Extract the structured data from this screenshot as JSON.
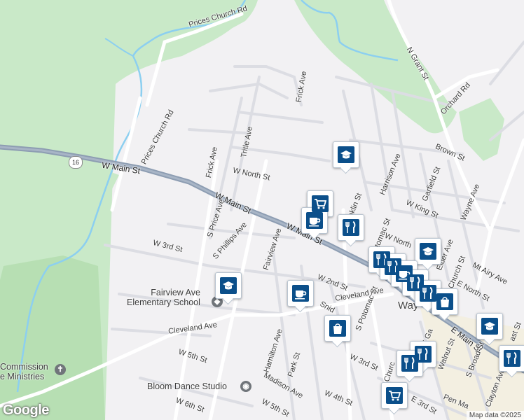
{
  "map": {
    "colors": {
      "land": "#f2f1f3",
      "forest": "#c9e9c8",
      "water": "#8ccff0",
      "highway": "#8d9db2",
      "street": "#ffffff",
      "minor": "#dcdde3",
      "marker": "#0b4f8a",
      "town": "#f4ecd2"
    },
    "route_shield": "16",
    "streets": [
      {
        "id": "prices-church-rd-top",
        "label": "Prices Church Rd"
      },
      {
        "id": "prices-church-rd-mid",
        "label": "Prices Church Rd"
      },
      {
        "id": "w-main-st-west",
        "label": "W Main St"
      },
      {
        "id": "w-main-st-center",
        "label": "W Main St"
      },
      {
        "id": "w-main-st-east",
        "label": "W Main St"
      },
      {
        "id": "e-main-st",
        "label": "E Main St"
      },
      {
        "id": "frick-ave-north",
        "label": "Frick Ave"
      },
      {
        "id": "frick-ave-west",
        "label": "Frick Ave"
      },
      {
        "id": "tritle-ave",
        "label": "Tritle Ave"
      },
      {
        "id": "w-north-st",
        "label": "W North St"
      },
      {
        "id": "w-north-st-east",
        "label": "W North"
      },
      {
        "id": "s-price-ave",
        "label": "S Price Ave"
      },
      {
        "id": "s-phillips-ave",
        "label": "S Phillips Ave"
      },
      {
        "id": "w-3rd-st-west",
        "label": "W 3rd St"
      },
      {
        "id": "fairview-ave",
        "label": "Fairview Ave"
      },
      {
        "id": "w-2nd-st",
        "label": "W 2nd St"
      },
      {
        "id": "cleveland-ave-east",
        "label": "Cleveland Ave"
      },
      {
        "id": "cleveland-ave-west",
        "label": "Cleveland Ave"
      },
      {
        "id": "w-5th-st-west",
        "label": "W 5th St"
      },
      {
        "id": "hamilton-ave",
        "label": "Hamilton Ave"
      },
      {
        "id": "park-st",
        "label": "Park St"
      },
      {
        "id": "madison-ave",
        "label": "Madison Ave"
      },
      {
        "id": "w-6th-st",
        "label": "W 6th St"
      },
      {
        "id": "w-5th-st-east",
        "label": "W 5th St"
      },
      {
        "id": "w-4th-st",
        "label": "W 4th St"
      },
      {
        "id": "w-3rd-st-east",
        "label": "W 3rd St"
      },
      {
        "id": "s-potomac-st",
        "label": "S Potomac St"
      },
      {
        "id": "snider",
        "label": "Snid"
      },
      {
        "id": "s-church",
        "label": "S Churc"
      },
      {
        "id": "e-3rd-st",
        "label": "E 3rd St"
      },
      {
        "id": "pen-mar",
        "label": "Pen Ma"
      },
      {
        "id": "clayton-ave",
        "label": "Clayton Ave"
      },
      {
        "id": "s-broad-st",
        "label": "S Broad St"
      },
      {
        "id": "walnut-st",
        "label": "Walnut St"
      },
      {
        "id": "e-gay-st",
        "label": "E Ga"
      },
      {
        "id": "n-grant-st",
        "label": "N Grant St"
      },
      {
        "id": "orchard-rd",
        "label": "Orchard Rd"
      },
      {
        "id": "brown-st",
        "label": "Brown St"
      },
      {
        "id": "harrison-ave",
        "label": "Harrison Ave"
      },
      {
        "id": "garfield-st",
        "label": "Garfield St"
      },
      {
        "id": "wayne-ave",
        "label": "Wayne Ave"
      },
      {
        "id": "w-king-st",
        "label": "W King St"
      },
      {
        "id": "n-franklin-st",
        "label": "N Franklin St"
      },
      {
        "id": "n-potomac-st",
        "label": "N Potomac St"
      },
      {
        "id": "elder-ave",
        "label": "Elder Ave"
      },
      {
        "id": "church-st",
        "label": "Church St"
      },
      {
        "id": "mt-airy-ave",
        "label": "Mt Airy Ave"
      },
      {
        "id": "e-north-st",
        "label": "E North St"
      },
      {
        "id": "east-st",
        "label": "ast St"
      },
      {
        "id": "waynesboro",
        "label": "Way"
      }
    ],
    "places": [
      {
        "id": "fairview-school",
        "lines": [
          "Fairview Ave",
          "Elementary School"
        ],
        "icon": "school-pin-icon"
      },
      {
        "id": "commission-ministries",
        "lines": [
          "Commission",
          "e Ministries"
        ],
        "icon": "church-pin-icon"
      },
      {
        "id": "bloom-dance",
        "lines": [
          "Bloom Dance Studio"
        ],
        "icon": "camera-pin-icon"
      }
    ],
    "markers": [
      {
        "id": "school-north",
        "type": "school"
      },
      {
        "id": "grocery-main",
        "type": "grocery"
      },
      {
        "id": "cafe-main",
        "type": "cafe"
      },
      {
        "id": "restaurant-main",
        "type": "restaurant"
      },
      {
        "id": "school-fairview",
        "type": "school"
      },
      {
        "id": "cafe-2nd",
        "type": "cafe"
      },
      {
        "id": "shopping-cleveland",
        "type": "shopping"
      },
      {
        "id": "school-downtown",
        "type": "school"
      },
      {
        "id": "cluster-1",
        "type": "restaurant"
      },
      {
        "id": "cluster-2",
        "type": "restaurant"
      },
      {
        "id": "cluster-3",
        "type": "cafe"
      },
      {
        "id": "cluster-4",
        "type": "restaurant"
      },
      {
        "id": "cluster-5",
        "type": "restaurant"
      },
      {
        "id": "shopping-downtown",
        "type": "shopping"
      },
      {
        "id": "school-east",
        "type": "school"
      },
      {
        "id": "restaurant-south-1",
        "type": "restaurant"
      },
      {
        "id": "restaurant-south-2",
        "type": "restaurant"
      },
      {
        "id": "restaurant-east",
        "type": "restaurant"
      },
      {
        "id": "grocery-south",
        "type": "grocery"
      }
    ],
    "attribution": {
      "logo": "Google",
      "data": "Map data ©2025"
    }
  }
}
